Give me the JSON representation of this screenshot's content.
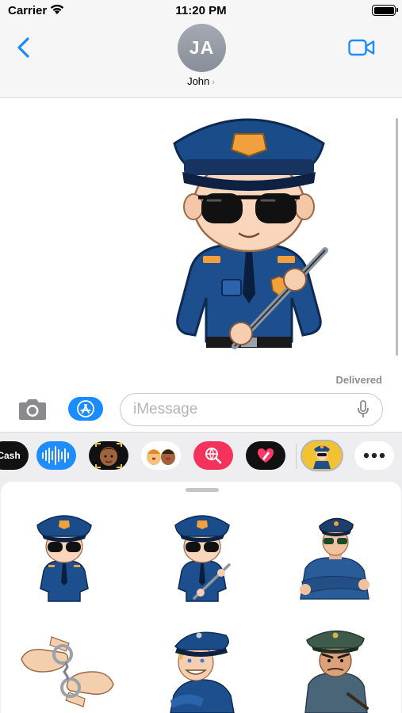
{
  "status_bar": {
    "carrier": "Carrier",
    "time": "11:20 PM"
  },
  "header": {
    "avatar_initials": "JA",
    "contact_name": "John",
    "contact_chevron": "›"
  },
  "conversation": {
    "status": "Delivered"
  },
  "composer": {
    "placeholder": "iMessage"
  },
  "app_strip": {
    "items": [
      {
        "icon": "apple-cash-icon",
        "label": "Cash"
      },
      {
        "icon": "audio-message-icon"
      },
      {
        "icon": "memoji-icon"
      },
      {
        "icon": "memoji-stickers-icon"
      },
      {
        "icon": "images-search-icon"
      },
      {
        "icon": "digital-touch-icon"
      },
      {
        "icon": "police-sticker-app-icon",
        "selected": true
      },
      {
        "icon": "more-apps-icon"
      }
    ]
  },
  "sticker_grid": {
    "items": [
      {
        "icon": "police-officer-sunglasses-sticker"
      },
      {
        "icon": "police-officer-baton-sticker"
      },
      {
        "icon": "police-officer-arms-crossed-sticker"
      },
      {
        "icon": "handcuffs-sticker"
      },
      {
        "icon": "police-officer-grinning-sticker"
      },
      {
        "icon": "angry-police-officer-sticker"
      }
    ]
  },
  "colors": {
    "accent": "#1a8cff",
    "uniform": "#1d4f8f",
    "cap": "#1b4c8a",
    "badge": "#f0a03c",
    "delivered_text": "#8e8e93"
  }
}
